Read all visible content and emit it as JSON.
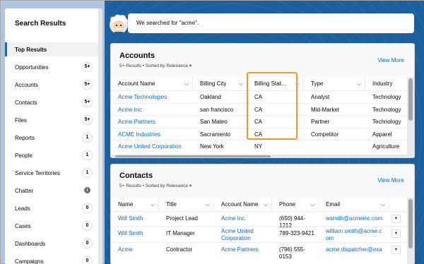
{
  "sidebar": {
    "title": "Search Results",
    "items": [
      {
        "label": "Top Results",
        "count": null,
        "active": true
      },
      {
        "label": "Opportunities",
        "count": "5+"
      },
      {
        "label": "Accounts",
        "count": "5+"
      },
      {
        "label": "Contacts",
        "count": "5+"
      },
      {
        "label": "Files",
        "count": "5+"
      },
      {
        "label": "Reports",
        "count": "1"
      },
      {
        "label": "People",
        "count": "1"
      },
      {
        "label": "Service Territories",
        "count": "1"
      },
      {
        "label": "Chatter",
        "count": "i"
      },
      {
        "label": "Leads",
        "count": "0"
      },
      {
        "label": "Cases",
        "count": "0"
      },
      {
        "label": "Dashboards",
        "count": "0"
      },
      {
        "label": "Campaigns",
        "count": "0"
      }
    ]
  },
  "banner": {
    "text": "We searched for \"acme\"."
  },
  "accounts": {
    "title": "Accounts",
    "subtitle": "5+ Results • Sorted by Relevance ▾",
    "view_more": "View More",
    "columns": [
      "Account Name",
      "Billing City",
      "Billing Stat...",
      "Type",
      "Industry"
    ],
    "rows": [
      [
        "Acme Technologies",
        "Oakland",
        "CA",
        "Analyst",
        "Technology"
      ],
      [
        "Acme Inc.",
        "san francisco",
        "CA",
        "Mid-Market",
        "Technology"
      ],
      [
        "Acme Partners",
        "San Mateo",
        "CA",
        "Partner",
        "Technology"
      ],
      [
        "ACME Industries",
        "Sacramento",
        "CA",
        "Competitor",
        "Apparel"
      ],
      [
        "Acme United Corporation",
        "New York",
        "NY",
        "",
        "Agriculture"
      ]
    ]
  },
  "contacts": {
    "title": "Contacts",
    "subtitle": "5+ Results • Sorted by Relevance ▾",
    "view_more": "View More",
    "columns": [
      "Name",
      "Title",
      "Account Name",
      "Phone",
      "Email"
    ],
    "rows": [
      [
        "Will Smith",
        "Project Lead",
        "Acme Inc.",
        "(650) 944-1212",
        "wsmith@acmeinc.com"
      ],
      [
        "Will Smith",
        "IT Manager",
        "Acme United\nCorporation",
        "789-323-9421",
        "william.smith@acme.c\nom"
      ],
      [
        "Acme",
        "Contractor",
        "Acme Partners",
        "(796) 555-0153",
        "acme.dispatcher@exa"
      ]
    ]
  },
  "colors": {
    "link": "#006dcc",
    "highlight": "#f3972b",
    "background": "#1b5f9e"
  }
}
